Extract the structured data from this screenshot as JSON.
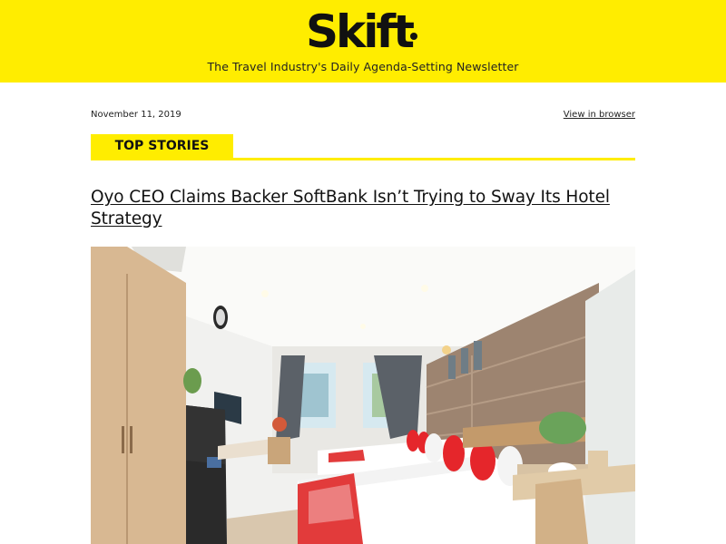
{
  "header": {
    "brand": "Skift",
    "tagline": "The Travel Industry's Daily Agenda-Setting Newsletter",
    "background_color": "#ffed00"
  },
  "meta": {
    "date": "November 11, 2019",
    "view_in_browser_label": "View in browser"
  },
  "section": {
    "label": "TOP STORIES",
    "accent_color": "#ffed00"
  },
  "story": {
    "headline": "Oyo CEO Claims Backer SoftBank Isn’t Trying to Sway Its Hotel Strategy",
    "image_description_icon": "hotel-room-photo"
  }
}
